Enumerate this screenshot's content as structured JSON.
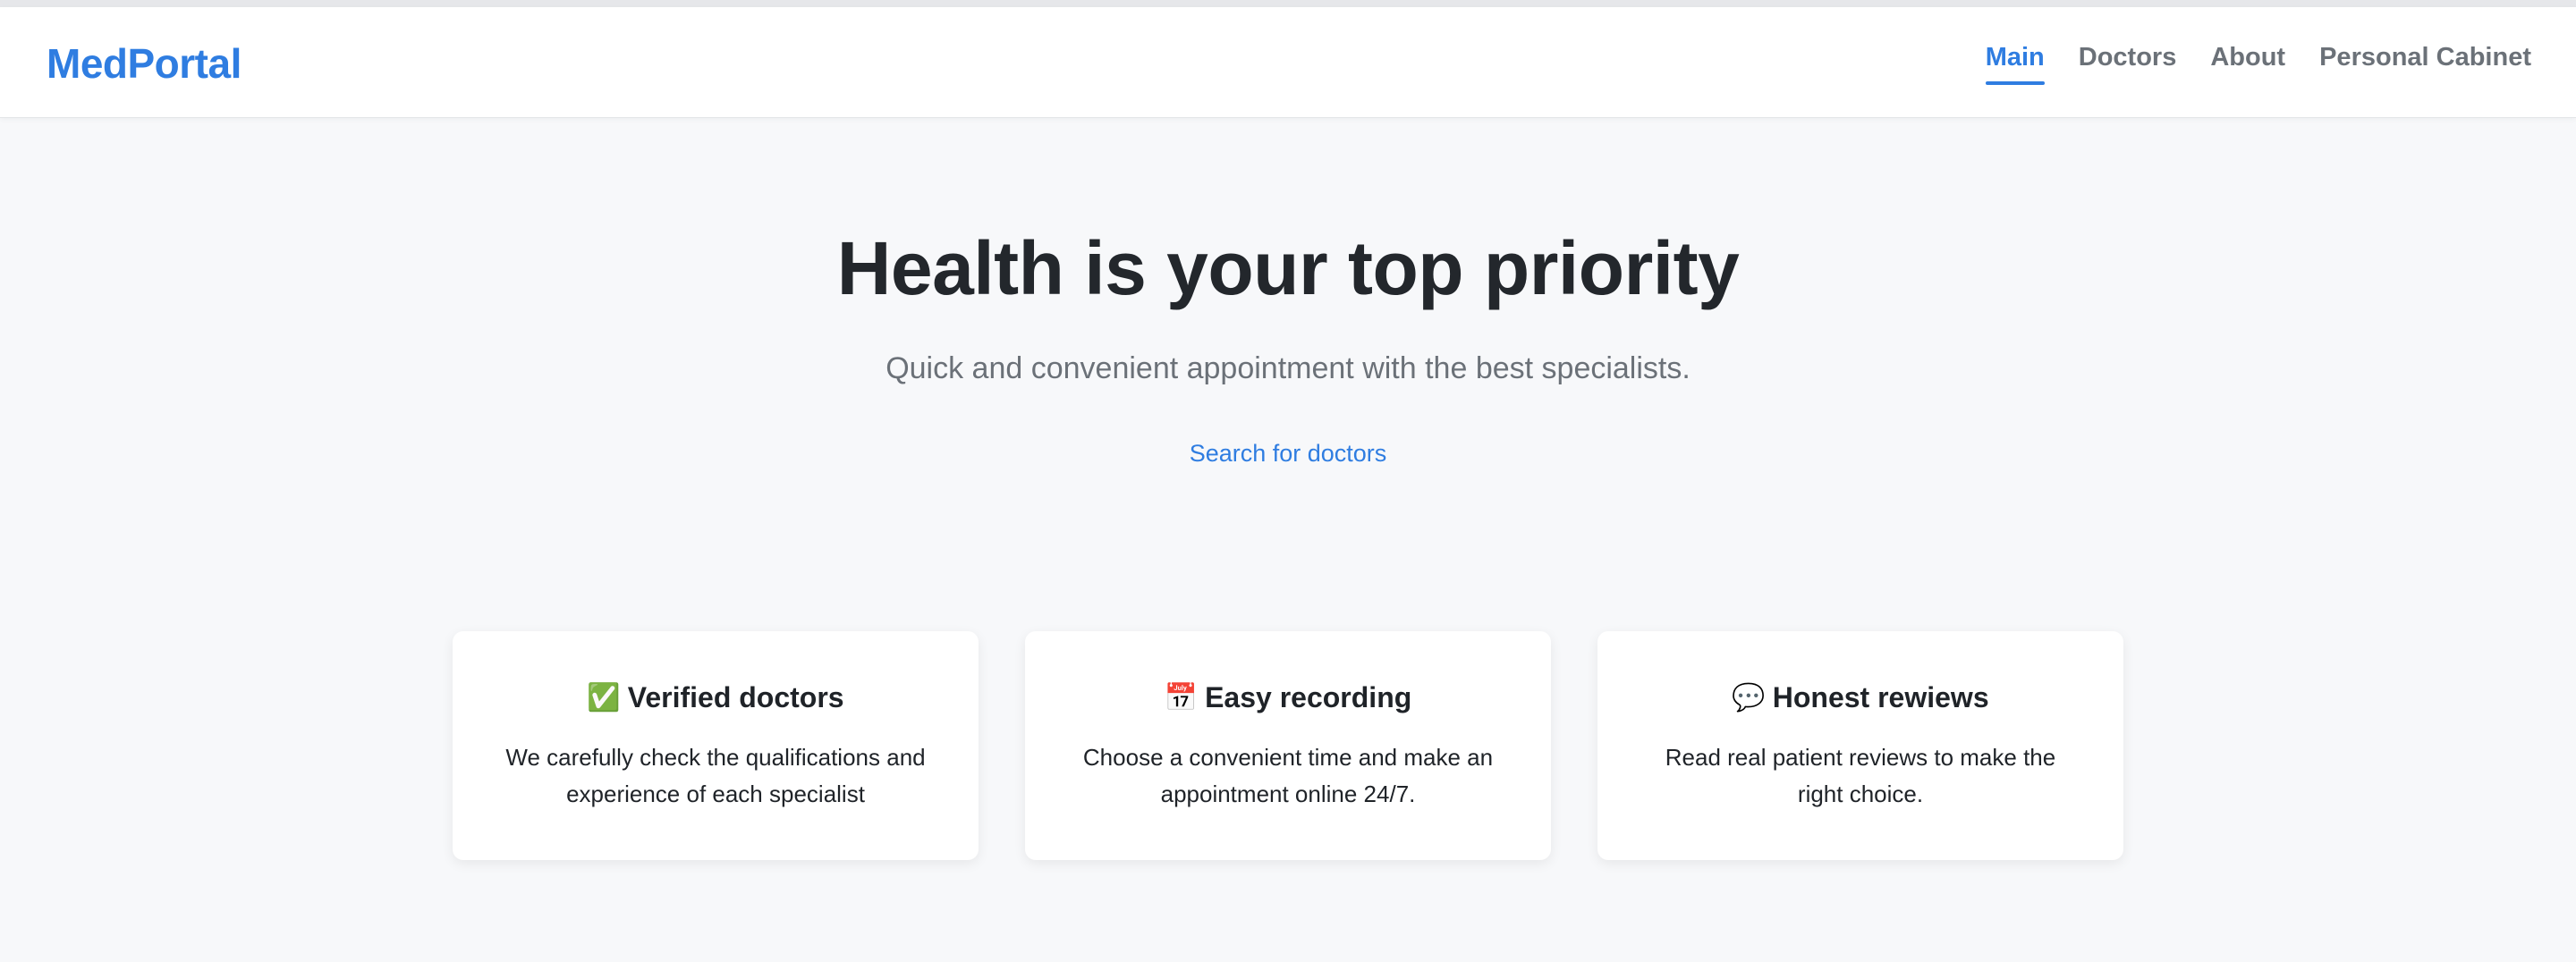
{
  "brand": {
    "logo_text": "MedPortal",
    "accent_color": "#2f7de1"
  },
  "nav": {
    "items": [
      {
        "label": "Main",
        "active": true
      },
      {
        "label": "Doctors",
        "active": false
      },
      {
        "label": "About",
        "active": false
      },
      {
        "label": "Personal Cabinet",
        "active": false
      }
    ]
  },
  "hero": {
    "title": "Health is your top priority",
    "subtitle": "Quick and convenient appointment with the best specialists.",
    "search_link": "Search for doctors"
  },
  "features": [
    {
      "icon": "check-mark-icon",
      "glyph": "✅",
      "title": "Verified doctors",
      "text": "We carefully check the qualifications and experience of each specialist"
    },
    {
      "icon": "calendar-icon",
      "glyph": "📅",
      "title": "Easy recording",
      "text": "Choose a convenient time and make an appointment online 24/7."
    },
    {
      "icon": "speech-bubble-icon",
      "glyph": "💬",
      "title": "Honest rewiews",
      "text": "Read real patient reviews to make the right choice."
    }
  ]
}
